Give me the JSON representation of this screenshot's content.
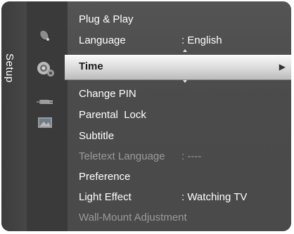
{
  "rail": {
    "label": "Setup"
  },
  "icons": [
    {
      "name": "satellite-dish-icon"
    },
    {
      "name": "gear-icon"
    },
    {
      "name": "input-plug-icon"
    },
    {
      "name": "picture-frame-icon"
    }
  ],
  "menu": {
    "items": [
      {
        "label": "Plug & Play",
        "value": "",
        "disabled": false
      },
      {
        "label": "Language",
        "value": ": English",
        "disabled": false
      },
      {
        "label": "Time",
        "value": "",
        "disabled": false,
        "selected": true
      },
      {
        "label": "Change PIN",
        "value": "",
        "disabled": false
      },
      {
        "label": "Parental  Lock",
        "value": "",
        "disabled": false
      },
      {
        "label": "Subtitle",
        "value": "",
        "disabled": false
      },
      {
        "label": "Teletext Language",
        "value": ": ----",
        "disabled": true
      },
      {
        "label": "Preference",
        "value": "",
        "disabled": false
      },
      {
        "label": "Light Effect",
        "value": ": Watching TV",
        "disabled": false
      },
      {
        "label": "Wall-Mount Adjustment",
        "value": "",
        "disabled": true
      }
    ],
    "selected_arrow": "▶"
  }
}
